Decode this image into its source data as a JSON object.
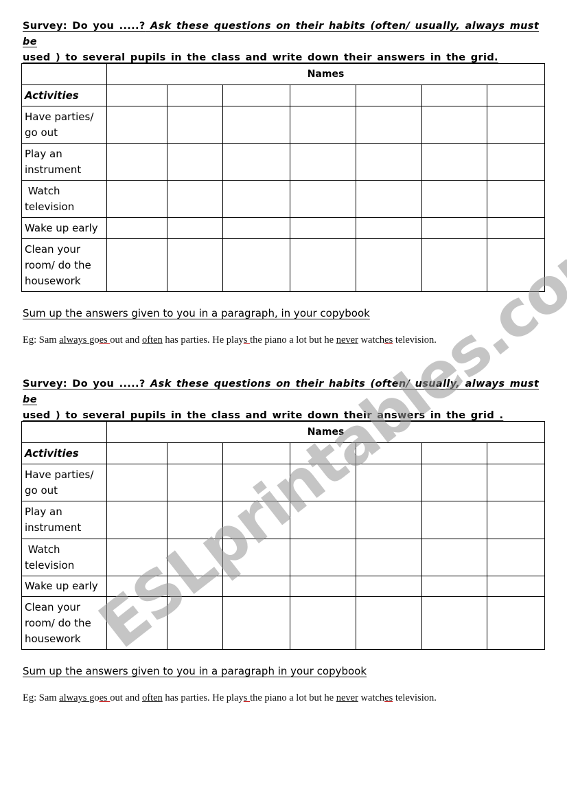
{
  "sections": [
    {
      "instruction_line1_a": "Survey: Do you .....?",
      "instruction_line1_b": "Ask these questions on their habits (often/ usually, always must be",
      "instruction_line2": "used ) to several pupils in the class and write down their answers in the grid.",
      "table": {
        "header": "Names",
        "activities_label": "Activities",
        "rows": [
          "Have parties/ go out",
          "Play an instrument",
          " Watch television",
          "Wake up early",
          "Clean your room/ do the housework"
        ]
      },
      "sumup": "Sum up the answers given to you in a paragraph, in your copybook",
      "example": {
        "prefix": "Eg: Sam ",
        "always": "always ",
        "go": "go",
        "es1": "es ",
        "out_and": "out and ",
        "often": "often",
        "has_parties": " has parties. He play",
        "s": "s ",
        "the_piano": "the piano a lot but he ",
        "never": "never",
        "watch": " watch",
        "es2": "es",
        "tv": " television."
      }
    },
    {
      "instruction_line1_a": "Survey: Do you .....?",
      "instruction_line1_b": "Ask these questions on their habits (often/ usually, always must be",
      "instruction_line2": "used ) to several pupils in the class and write down their answers in the grid .",
      "table": {
        "header": "Names",
        "activities_label": "Activities",
        "rows": [
          "Have parties/ go out",
          "Play an instrument",
          " Watch television",
          "Wake up early",
          "Clean your room/ do the housework"
        ]
      },
      "sumup": "Sum up the answers given to you in a paragraph in your copybook",
      "example": {
        "prefix": "Eg: Sam ",
        "always": "always ",
        "go": "go",
        "es1": "es ",
        "out_and": "out and ",
        "often": "often",
        "has_parties": " has parties. He play",
        "s": "s ",
        "the_piano": "the piano a lot but he ",
        "never": "never",
        "watch": " watch",
        "es2": "es",
        "tv": " television."
      }
    }
  ],
  "watermark": "ESLprintables.com",
  "colors": {
    "underline_red": "#c00000",
    "watermark": "#969696"
  }
}
